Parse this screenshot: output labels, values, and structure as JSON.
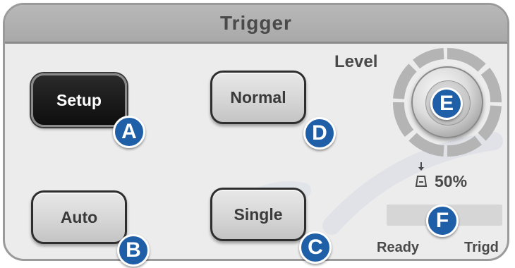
{
  "panel": {
    "title": "Trigger"
  },
  "buttons": {
    "setup": "Setup",
    "normal": "Normal",
    "auto": "Auto",
    "single": "Single"
  },
  "markers": {
    "a": "A",
    "b": "B",
    "c": "C",
    "d": "D",
    "e": "E",
    "f": "F"
  },
  "level": {
    "label": "Level",
    "percent": "50%",
    "icon": "level-50-percent-icon"
  },
  "status": {
    "ready": "Ready",
    "trigd": "Trigd"
  },
  "colors": {
    "marker_blue": "#1f5fa8",
    "setup_active": "#111111",
    "panel_bg": "#ececec",
    "header_bg": "#aeaeae"
  }
}
